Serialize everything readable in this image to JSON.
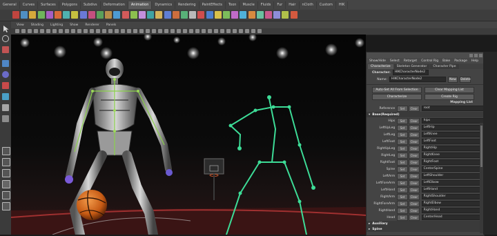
{
  "shelf": {
    "tabs": [
      "General",
      "Curves",
      "Surfaces",
      "Polygons",
      "Subdivs",
      "Deformation",
      "Animation",
      "Dynamics",
      "Rendering",
      "PaintEffects",
      "Toon",
      "Muscle",
      "Fluids",
      "Fur",
      "Hair",
      "nCloth",
      "Custom",
      "HIK"
    ],
    "active_tab": "Animation",
    "icon_colors": [
      "#c0453f",
      "#4f8fc4",
      "#d7a93b",
      "#6fb55b",
      "#a75ec3",
      "#d86a3a",
      "#4fb2b0",
      "#c7c13f",
      "#6a79d6",
      "#c4507f",
      "#5aa05a",
      "#b78d4a",
      "#4d9bd3",
      "#d25a5a",
      "#8cbf4e",
      "#c38fdc",
      "#3fa3a3",
      "#d4b35a",
      "#5f7ed4",
      "#cc6e3e",
      "#58b078",
      "#b9b9b9",
      "#cf4d4d",
      "#4d7fcf",
      "#d8c04a",
      "#7dbd5b",
      "#bf6bc9",
      "#4fb0d8",
      "#d88a3f",
      "#6ac1a0",
      "#c95a8d",
      "#8d8dd8",
      "#b0c04a",
      "#d45a3f"
    ]
  },
  "panel_menu": {
    "items": [
      "View",
      "Shading",
      "Lighting",
      "Show",
      "Renderer",
      "Panels"
    ]
  },
  "hik": {
    "menu": [
      "Show/Hide",
      "Select",
      "Retarget",
      "Control Rig",
      "Bake",
      "Package",
      "Help"
    ],
    "tabs": [
      "Characterize",
      "Skeleton Generator",
      "Character Pipe"
    ],
    "active_tab": "Characterize",
    "character_label": "Character:",
    "character_value": "HIKCharacterNode2",
    "name_label": "Name:",
    "name_value": "HIKCharacterNode2",
    "new_label": "New",
    "delete_label": "Delete",
    "auto_set_label": "Auto-Set All From Selection",
    "clear_mapping_label": "Clear Mapping List",
    "characterize_label": "Characterize",
    "create_rig_label": "Create Rig",
    "mapping_list_label": "Mapping List",
    "reference_label": "Reference",
    "reference_value": "root",
    "set_label": "Set",
    "clear_label": "Clear",
    "base_section": "Base(Required)",
    "mappings": [
      {
        "name": "Hips",
        "value": "hips"
      },
      {
        "name": "LeftUpLeg",
        "value": "LeftHip"
      },
      {
        "name": "LeftLeg",
        "value": "LeftKnee"
      },
      {
        "name": "LeftFoot",
        "value": "LeftFoot"
      },
      {
        "name": "RightUpLeg",
        "value": "RightHip"
      },
      {
        "name": "RightLeg",
        "value": "RightKnee"
      },
      {
        "name": "RightFoot",
        "value": "RightFoot"
      },
      {
        "name": "Spine",
        "value": "CenterSpine"
      },
      {
        "name": "LeftArm",
        "value": "LeftShoulder"
      },
      {
        "name": "LeftForeArm",
        "value": "LeftElbow"
      },
      {
        "name": "LeftHand",
        "value": "LeftHand"
      },
      {
        "name": "RightArm",
        "value": "RightShoulder"
      },
      {
        "name": "RightForeArm",
        "value": "RightElbow"
      },
      {
        "name": "RightHand",
        "value": "RightHand"
      },
      {
        "name": "Head",
        "value": "CenterHead"
      }
    ],
    "collapsed_sections": [
      "Auxiliary",
      "Spine"
    ]
  },
  "colors": {
    "skeleton_green": "#3ddc97",
    "ball_orange": "#d86a1e",
    "robot_silver": "#c8c8c8",
    "court_red": "#7a1d1d"
  }
}
